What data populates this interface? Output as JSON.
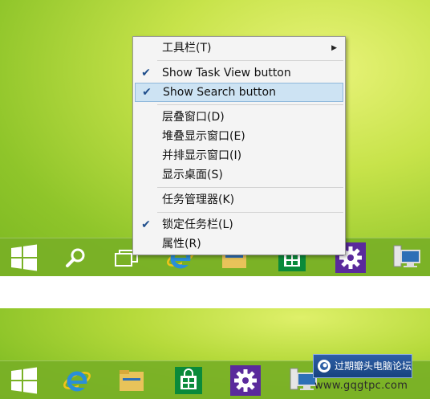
{
  "context_menu": {
    "items": [
      {
        "label": "工具栏(T)",
        "checked": false,
        "submenu": true
      },
      {
        "label": "Show Task View button",
        "checked": true
      },
      {
        "label": "Show Search button",
        "checked": true,
        "highlighted": true
      },
      {
        "label": "层叠窗口(D)",
        "checked": false
      },
      {
        "label": "堆叠显示窗口(E)",
        "checked": false
      },
      {
        "label": "并排显示窗口(I)",
        "checked": false
      },
      {
        "label": "显示桌面(S)",
        "checked": false
      },
      {
        "label": "任务管理器(K)",
        "checked": false
      },
      {
        "label": "锁定任务栏(L)",
        "checked": true
      },
      {
        "label": "属性(R)",
        "checked": false
      }
    ],
    "check_glyph": "✔",
    "submenu_arrow": "▶"
  },
  "taskbar_top": {
    "icons": [
      "windows-start-icon",
      "search-icon",
      "task-view-icon",
      "internet-explorer-icon",
      "file-explorer-icon",
      "store-icon",
      "settings-gear-icon",
      "network-computer-icon"
    ]
  },
  "taskbar_bottom": {
    "icons": [
      "windows-start-icon",
      "internet-explorer-icon",
      "file-explorer-icon",
      "store-icon",
      "settings-gear-icon",
      "network-computer-icon"
    ]
  },
  "watermark": {
    "title": "过期瓣头电脑论坛",
    "url": "www.gqgtpc.com"
  },
  "colors": {
    "menu_highlight": "#cde3f3",
    "check_color": "#1f4e8c",
    "store_green": "#0a8a3a",
    "settings_purple": "#5a2a9c",
    "ie_blue": "#2a8fd8"
  }
}
